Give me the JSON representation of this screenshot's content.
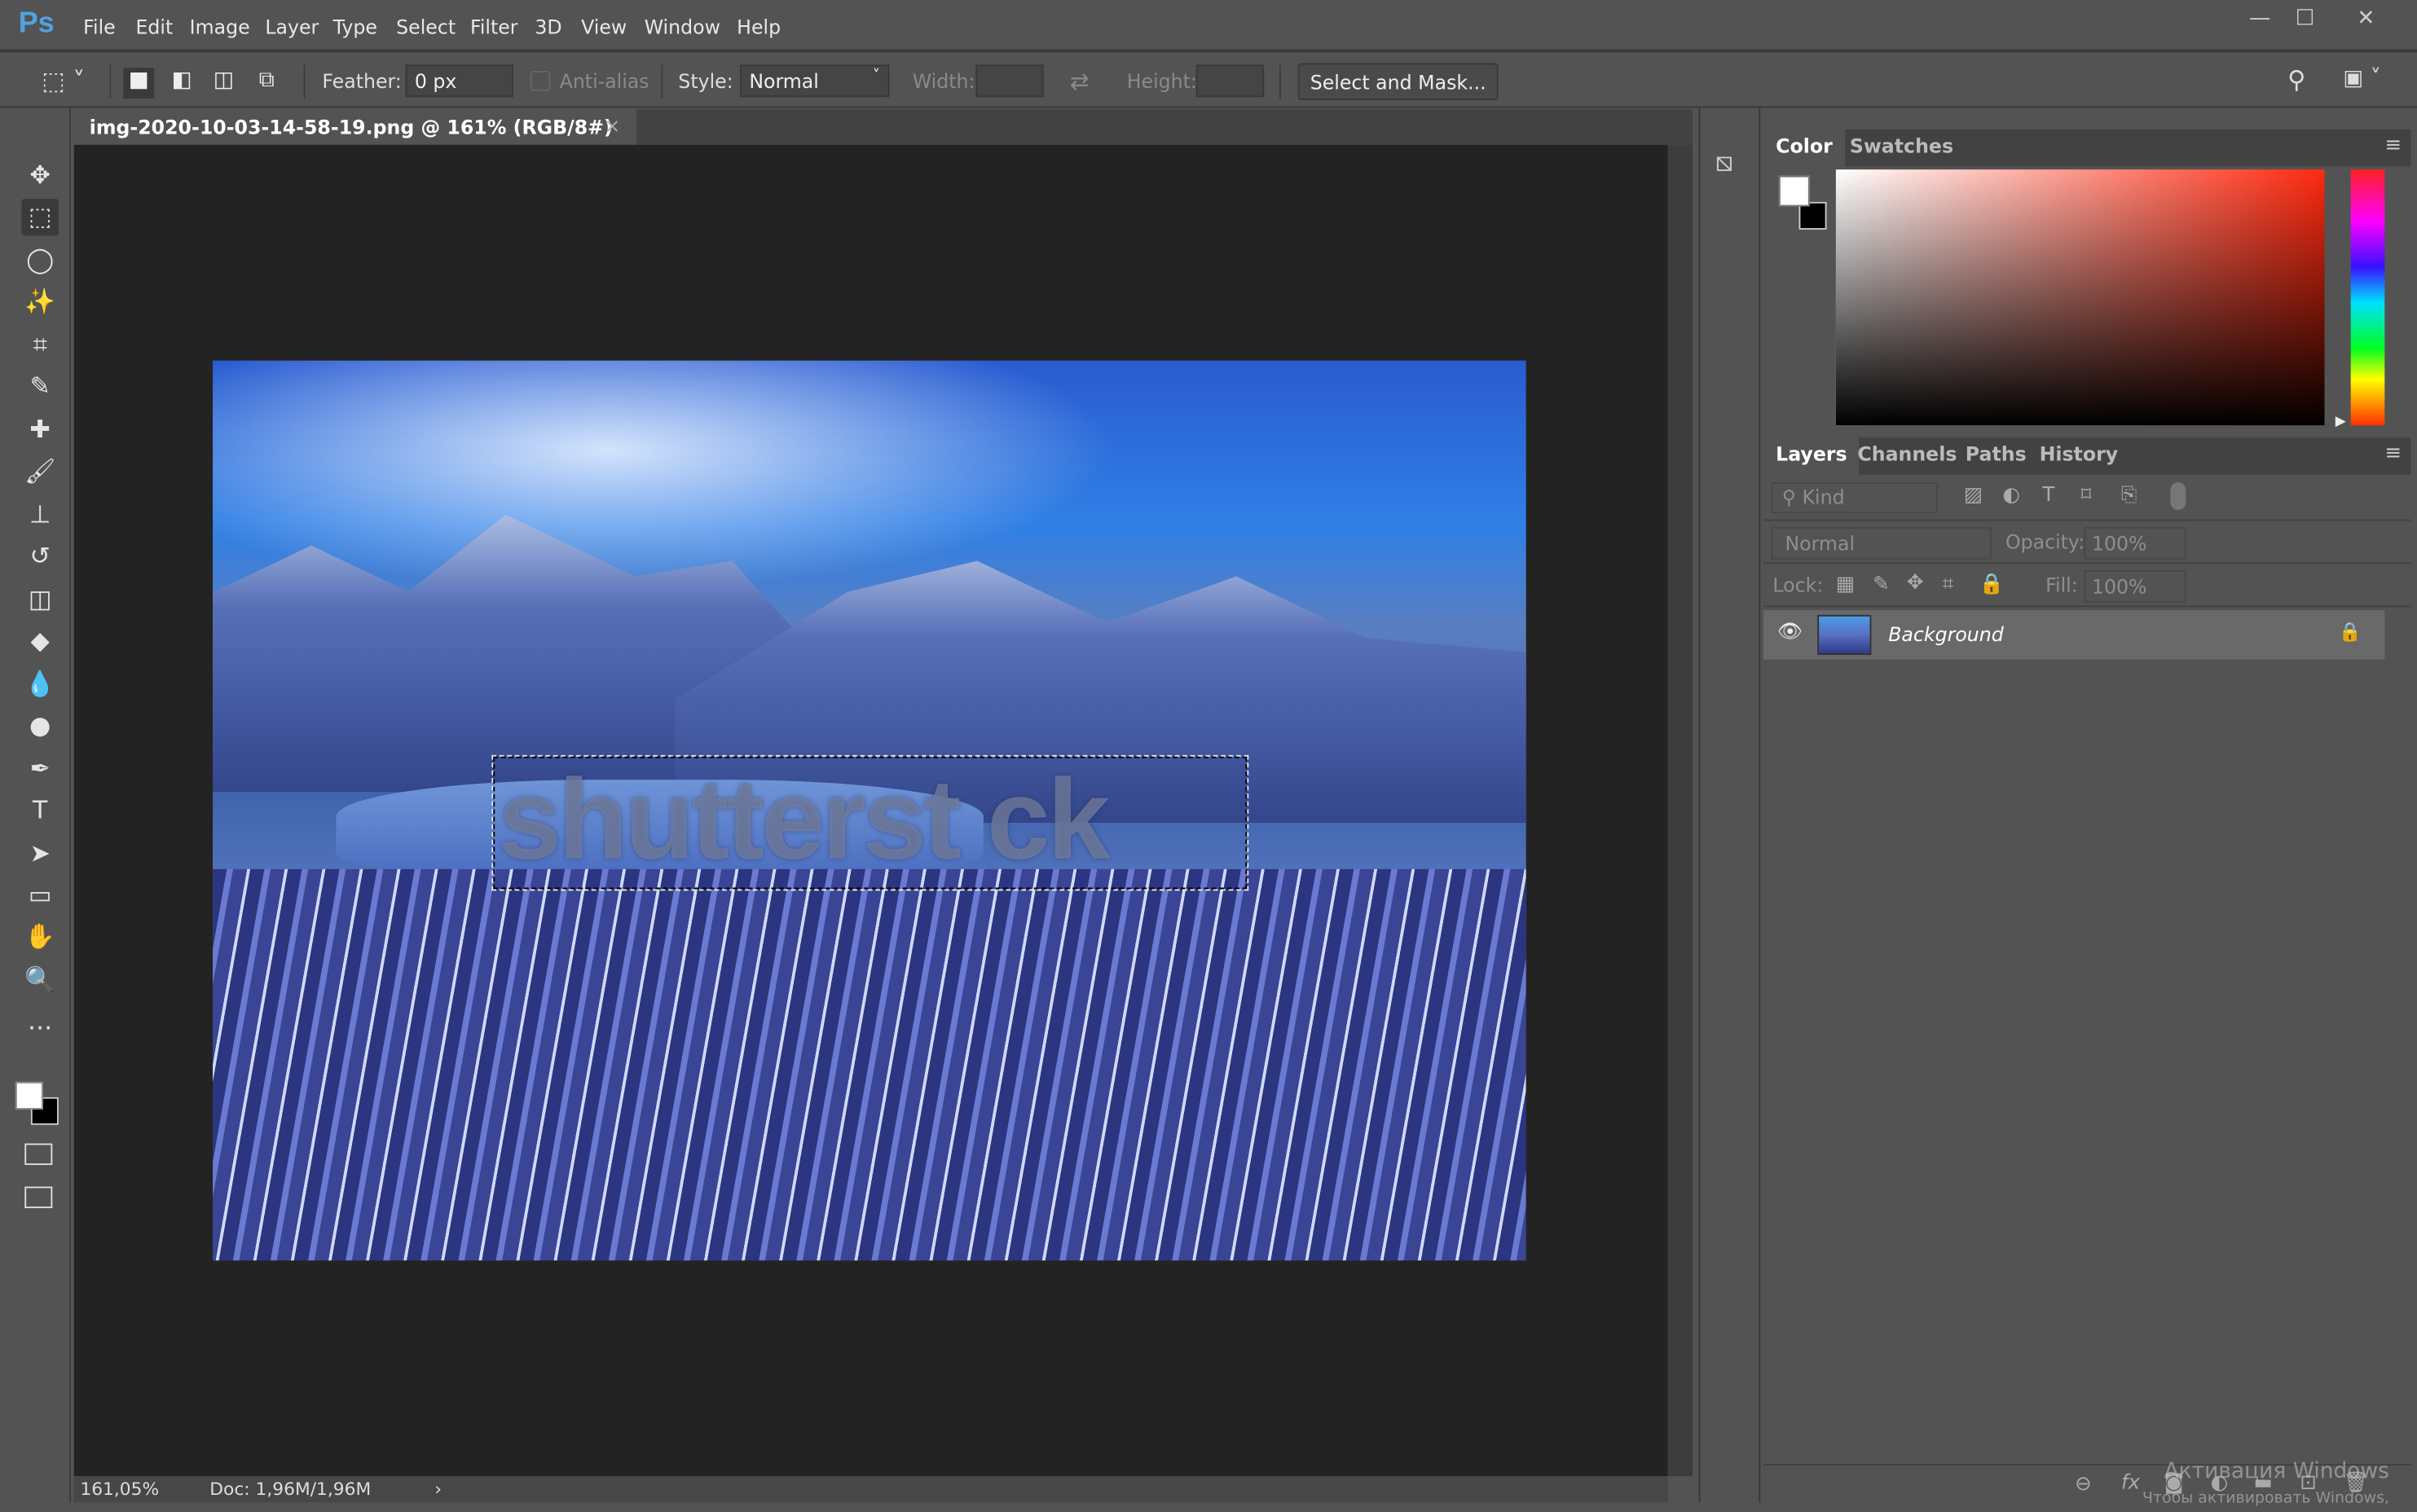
{
  "app": {
    "logo": "Ps",
    "window_controls": {
      "minimize": "—",
      "maximize": "☐",
      "close": "✕"
    }
  },
  "menu": [
    "File",
    "Edit",
    "Image",
    "Layer",
    "Type",
    "Select",
    "Filter",
    "3D",
    "View",
    "Window",
    "Help"
  ],
  "options": {
    "feather_label": "Feather:",
    "feather_value": "0 px",
    "antialias_label": "Anti-alias",
    "style_label": "Style:",
    "style_value": "Normal",
    "width_label": "Width:",
    "height_label": "Height:",
    "select_mask_label": "Select and Mask..."
  },
  "document": {
    "tab_title": "img-2020-10-03-14-58-19.png @ 161% (RGB/8#)",
    "close": "×",
    "image_watermark": "shutterst ck"
  },
  "tools": [
    {
      "name": "move",
      "glyph": "✥"
    },
    {
      "name": "rectangular-marquee",
      "glyph": "⬚",
      "active": true
    },
    {
      "name": "lasso",
      "glyph": "◯"
    },
    {
      "name": "magic-wand",
      "glyph": "✨"
    },
    {
      "name": "crop",
      "glyph": "⌗"
    },
    {
      "name": "eyedropper",
      "glyph": "✎"
    },
    {
      "name": "healing-brush",
      "glyph": "✚"
    },
    {
      "name": "brush",
      "glyph": "🖌"
    },
    {
      "name": "clone-stamp",
      "glyph": "⊥"
    },
    {
      "name": "history-brush",
      "glyph": "↺"
    },
    {
      "name": "eraser",
      "glyph": "◫"
    },
    {
      "name": "paint-bucket",
      "glyph": "◆"
    },
    {
      "name": "blur",
      "glyph": "💧"
    },
    {
      "name": "dodge",
      "glyph": "●"
    },
    {
      "name": "pen",
      "glyph": "✒"
    },
    {
      "name": "type",
      "glyph": "T"
    },
    {
      "name": "path-selection",
      "glyph": "➤"
    },
    {
      "name": "rectangle",
      "glyph": "▭"
    },
    {
      "name": "hand",
      "glyph": "✋"
    },
    {
      "name": "zoom",
      "glyph": "🔍"
    },
    {
      "name": "more",
      "glyph": "…"
    }
  ],
  "status": {
    "zoom": "161,05%",
    "doc": "Doc: 1,96M/1,96M",
    "arrow": "›"
  },
  "color_panel": {
    "tabs": [
      "Color",
      "Swatches"
    ],
    "active": "Color",
    "foreground": "#ffffff",
    "background": "#000000",
    "hue": "#ff2a10"
  },
  "layers_panel": {
    "tabs": [
      "Layers",
      "Channels",
      "Paths",
      "History"
    ],
    "active": "Layers",
    "filter_placeholder": "Kind",
    "blend_mode": "Normal",
    "opacity_label": "Opacity:",
    "opacity_value": "100%",
    "lock_label": "Lock:",
    "fill_label": "Fill:",
    "fill_value": "100%",
    "layers": [
      {
        "name": "Background",
        "visible": true,
        "locked": true
      }
    ]
  },
  "windows_watermark": {
    "line1": "Активация Windows",
    "line2": "Чтобы активировать Windows,"
  }
}
